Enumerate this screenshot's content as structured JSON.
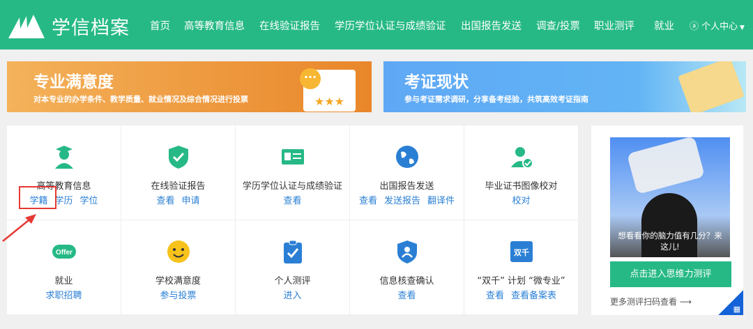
{
  "header": {
    "logo": "学信档案",
    "nav": [
      "首页",
      "高等教育信息",
      "在线验证报告",
      "学历学位认证与成绩验证",
      "出国报告发送",
      "调查/投票",
      "职业测评",
      "就业"
    ],
    "user_menu": "个人中心"
  },
  "banners": [
    {
      "title": "专业满意度",
      "subtitle": "对本专业的办学条件、教学质量、就业情况及综合情况进行投票"
    },
    {
      "title": "考证现状",
      "subtitle": "参与考证需求调研，分享备考经验，共筑高效考证指南"
    }
  ],
  "services": [
    {
      "title": "高等教育信息",
      "links": [
        "学籍",
        "学历",
        "学位"
      ],
      "icon": "graduate-icon"
    },
    {
      "title": "在线验证报告",
      "links": [
        "查看",
        "申请"
      ],
      "icon": "shield-check-icon"
    },
    {
      "title": "学历学位认证与成绩验证",
      "links": [
        "查看"
      ],
      "icon": "id-card-icon"
    },
    {
      "title": "出国报告发送",
      "links": [
        "查看",
        "发送报告",
        "翻译件"
      ],
      "icon": "globe-icon"
    },
    {
      "title": "毕业证书图像校对",
      "links": [
        "校对"
      ],
      "icon": "user-check-icon"
    },
    {
      "title": "就业",
      "links": [
        "求职招聘"
      ],
      "icon": "offer-icon",
      "badge": "Offer"
    },
    {
      "title": "学校满意度",
      "links": [
        "参与投票"
      ],
      "icon": "smiley-icon"
    },
    {
      "title": "个人测评",
      "links": [
        "进入"
      ],
      "icon": "clipboard-check-icon"
    },
    {
      "title": "信息核查确认",
      "links": [
        "查看"
      ],
      "icon": "user-shield-icon"
    },
    {
      "title": "“双千” 计划 “微专业”",
      "links": [
        "查看",
        "查看备案表"
      ],
      "icon": "shuangqian-icon",
      "badge": "双千"
    }
  ],
  "side": {
    "image_caption": "想看看你的脑力值有几分？来这儿!",
    "button": "点击进入思维力测评",
    "more": "更多测评扫码查看 ⟶"
  },
  "colors": {
    "brand": "#26b986",
    "link": "#2a7fd4",
    "highlight": "#e53935"
  }
}
